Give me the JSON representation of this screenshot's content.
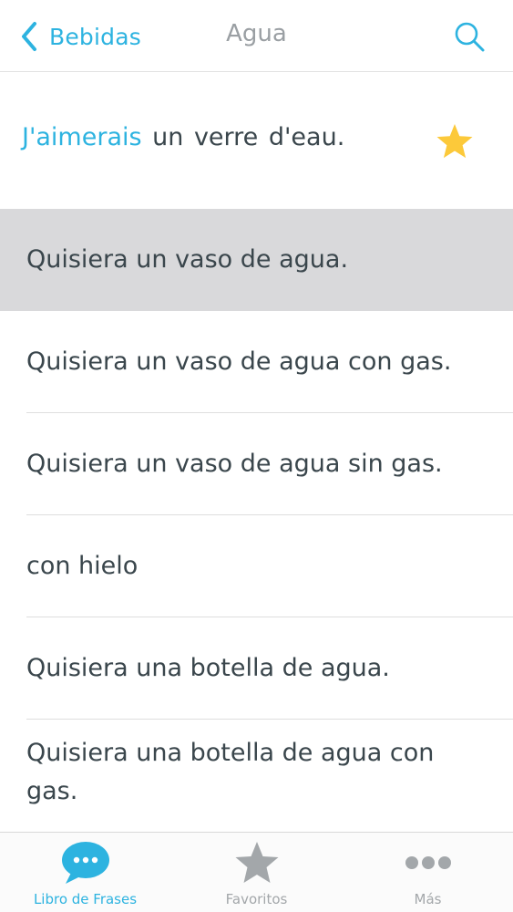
{
  "nav": {
    "back_label": "Bebidas",
    "title": "Agua"
  },
  "featured": {
    "highlight": "J'aimerais",
    "rest": " un verre d'eau.",
    "favorited": true
  },
  "phrases": [
    {
      "text": "Quisiera un vaso de agua.",
      "selected": true
    },
    {
      "text": "Quisiera un vaso de agua con gas."
    },
    {
      "text": "Quisiera un vaso de agua sin gas."
    },
    {
      "text": "con hielo"
    },
    {
      "text": "Quisiera una botella de agua."
    },
    {
      "text": "Quisiera una botella de agua con gas."
    }
  ],
  "tabs": [
    {
      "label": "Libro de Frases",
      "icon": "speech-bubble-icon",
      "active": true
    },
    {
      "label": "Favoritos",
      "icon": "star-icon"
    },
    {
      "label": "Más",
      "icon": "more-dots-icon"
    }
  ],
  "colors": {
    "accent": "#2db3e0",
    "star": "#fcc93a",
    "selected_row": "#d9d9db",
    "text": "#3a464c"
  }
}
